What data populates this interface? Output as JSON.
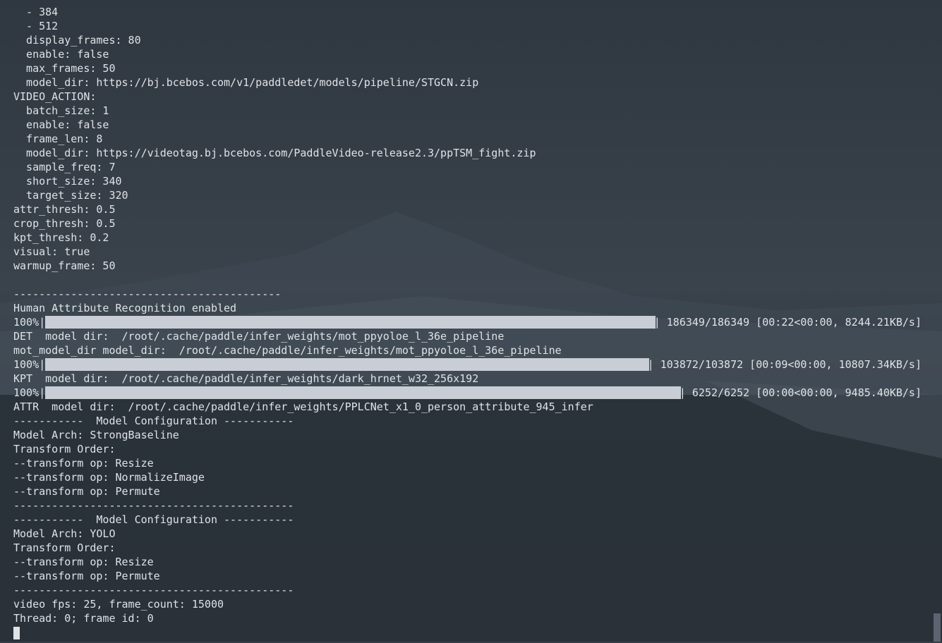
{
  "terminal": {
    "lines_top": [
      "  - 384",
      "  - 512",
      "  display_frames: 80",
      "  enable: false",
      "  max_frames: 50",
      "  model_dir: https://bj.bcebos.com/v1/paddledet/models/pipeline/STGCN.zip",
      "VIDEO_ACTION:",
      "  batch_size: 1",
      "  enable: false",
      "  frame_len: 8",
      "  model_dir: https://videotag.bj.bcebos.com/PaddleVideo-release2.3/ppTSM_fight.zip",
      "  sample_freq: 7",
      "  short_size: 340",
      "  target_size: 320",
      "attr_thresh: 0.5",
      "crop_thresh: 0.5",
      "kpt_thresh: 0.2",
      "visual: true",
      "warmup_frame: 50",
      "",
      "------------------------------------------",
      "Human Attribute Recognition enabled"
    ],
    "progress1": {
      "label": "100%|",
      "stats": "| 186349/186349 [00:22<00:00, 8244.21KB/s]",
      "percent": 100
    },
    "det_line": "DET  model dir:  /root/.cache/paddle/infer_weights/mot_ppyoloe_l_36e_pipeline",
    "mot_line": "mot_model_dir model_dir:  /root/.cache/paddle/infer_weights/mot_ppyoloe_l_36e_pipeline",
    "progress2": {
      "label": "100%|",
      "stats": "| 103872/103872 [00:09<00:00, 10807.34KB/s]",
      "percent": 100
    },
    "kpt_line": "KPT  model dir:  /root/.cache/paddle/infer_weights/dark_hrnet_w32_256x192",
    "progress3": {
      "label": "100%|",
      "stats": "| 6252/6252 [00:00<00:00, 9485.40KB/s]",
      "percent": 100
    },
    "lines_bottom": [
      "ATTR  model dir:  /root/.cache/paddle/infer_weights/PPLCNet_x1_0_person_attribute_945_infer",
      "-----------  Model Configuration -----------",
      "Model Arch: StrongBaseline",
      "Transform Order:",
      "--transform op: Resize",
      "--transform op: NormalizeImage",
      "--transform op: Permute",
      "--------------------------------------------",
      "-----------  Model Configuration -----------",
      "Model Arch: YOLO",
      "Transform Order:",
      "--transform op: Resize",
      "--transform op: Permute",
      "--------------------------------------------",
      "video fps: 25, frame_count: 15000",
      "Thread: 0; frame id: 0"
    ]
  },
  "colors": {
    "background": "#343c45",
    "text": "#dfe3e7",
    "progress_fill": "#c9ced6"
  }
}
